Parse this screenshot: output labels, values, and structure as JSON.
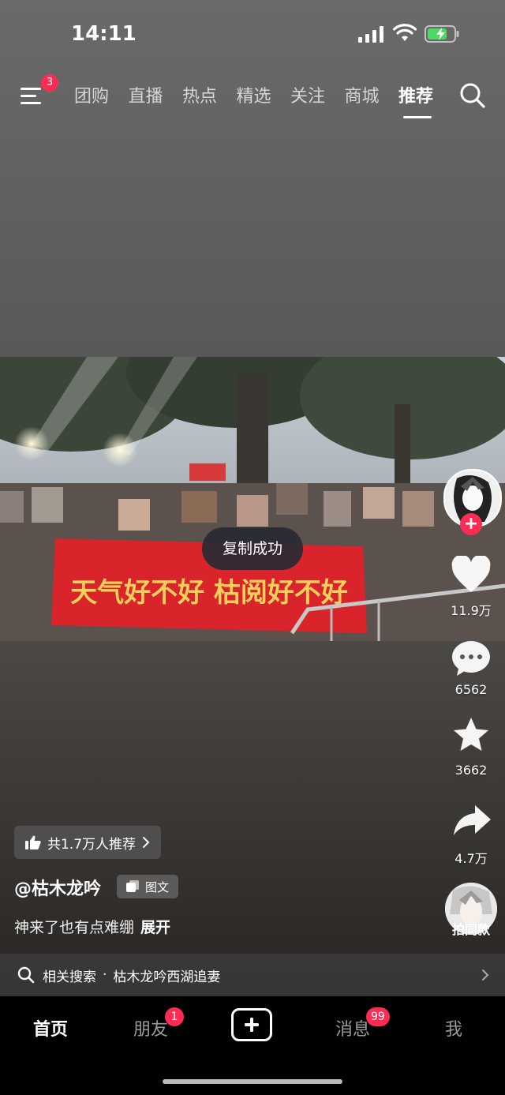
{
  "status_bar": {
    "time": "14:11"
  },
  "top_nav": {
    "menu_badge": "3",
    "tabs": [
      {
        "label": "团购"
      },
      {
        "label": "直播"
      },
      {
        "label": "热点"
      },
      {
        "label": "精选"
      },
      {
        "label": "关注"
      },
      {
        "label": "商城"
      },
      {
        "label": "推荐"
      }
    ],
    "active_tab": "推荐"
  },
  "photo": {
    "banner_text": "天气好不好 枯阅好不好"
  },
  "toast": "复制成功",
  "side_actions": {
    "like_count": "11.9万",
    "comment_count": "6562",
    "favorite_count": "3662",
    "share_count": "4.7万",
    "remix_label": "拍同款"
  },
  "post": {
    "recommend_pill": "共1.7万人推荐",
    "author": "@枯木龙吟",
    "type_tag": "图文",
    "description": "神来了也有点难绷",
    "expand_label": "展开",
    "related_prefix": "相关搜索",
    "related_query": "枯木龙吟西湖追妻"
  },
  "bottom_tabs": {
    "home": "首页",
    "friends": "朋友",
    "friends_badge": "1",
    "messages": "消息",
    "messages_badge": "99",
    "me": "我"
  },
  "colors": {
    "accent": "#fe2c55",
    "banner_red": "#d8242a",
    "banner_text": "#f6d05a"
  }
}
